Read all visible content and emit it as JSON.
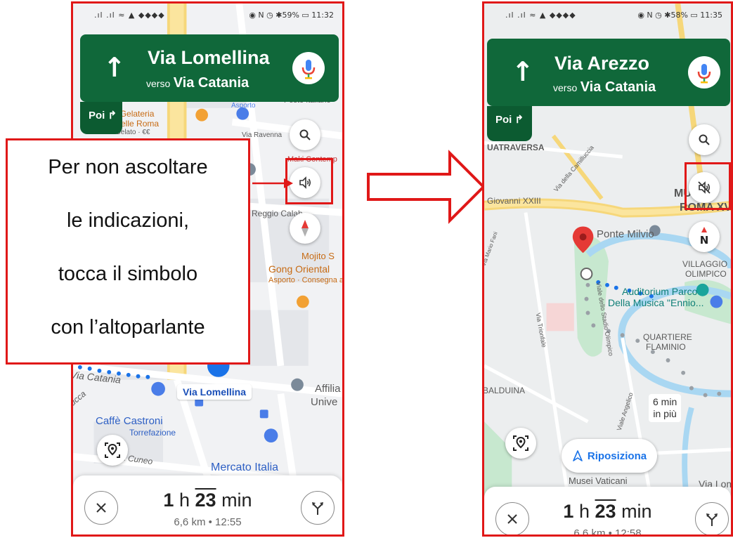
{
  "left_phone": {
    "status": {
      "left_icons": ".ıl .ıl ≈ ▲ ◆◆◆◆",
      "right_icons": "◉ N ◷ ✱59% ▭",
      "time": "11:32"
    },
    "nav": {
      "street": "Via Lomellina",
      "verso": "verso",
      "toward": "Via Catania"
    },
    "poi_label": "Poi ↱",
    "map_labels": {
      "bar": "etteria e Gelateria",
      "bar2": "Ma Belle Roma",
      "bar3": "Gelato · €€",
      "asporto": "Asporto",
      "poste": "Poste Italiane",
      "ravenna": "Via Ravenna",
      "maki": "Maki Contemp",
      "reggio": "Reggio Calab",
      "mojito": "Mojito S",
      "gong": "Gong Oriental",
      "gong_sub": "Asporto · Consegna a",
      "catania": "Via Catania",
      "cca": "ucca",
      "affili": "Affilia",
      "unive": "Unive",
      "caffe": "Caffè Castroni",
      "torre": "Torrefazione",
      "cuneo": "a Cuneo",
      "mercato": "Mercato Italia"
    },
    "street_chip": "Via Lomellina",
    "bottom": {
      "hours": "1",
      "h": "h",
      "minutes": "23",
      "min": "min",
      "sub": "6,6 km  •  12:55"
    }
  },
  "callout": {
    "line1": "Per non ascoltare",
    "line2": "le indicazioni,",
    "line3": "tocca il simbolo",
    "line4": "con l’altoparlante"
  },
  "right_phone": {
    "status": {
      "left_icons": ".ıl .ıl ≈ ▲ ◆◆◆◆",
      "right_icons": "◉ N ◷ ✱58% ▭",
      "time": "11:35"
    },
    "nav": {
      "street": "Via Arezzo",
      "verso": "verso",
      "toward": "Via Catania"
    },
    "poi_label": "Poi ↱",
    "map_labels": {
      "traversa": "UATRAVERSA",
      "giovanni": "Giovanni XXIII",
      "camilluccia": "Via della Camilluccia",
      "munic": "MUNIC",
      "roma": "ROMA XV",
      "ponte": "Ponte Milvio",
      "villaggio": "VILLAGGIO",
      "olimpico": "OLIMPICO",
      "auditorium": "Auditorium Parco",
      "musica": "Della Musica \"Ennio...",
      "quartiere": "QUARTIERE",
      "flaminio": "FLAMINIO",
      "stadio": "Viale dello Stadio Olimpico",
      "trionfale": "Via Trionfale",
      "angelico": "Viale Angelico",
      "balduina": "BALDUINA",
      "musei": "Musei Vaticani",
      "vialom": "Via Lom",
      "mario": "Via Mario Fani"
    },
    "delay": {
      "line1": "6 min",
      "line2": "in più"
    },
    "reposition": "Riposiziona",
    "bottom": {
      "hours": "1",
      "h": "h",
      "minutes": "23",
      "min": "min",
      "sub": "6,6 km  •  12:58"
    }
  },
  "icons": {
    "compass_letter": "N"
  },
  "colors": {
    "nav_green": "#10683a",
    "highlight_red": "#e01818",
    "route_blue": "#1a73e8"
  }
}
